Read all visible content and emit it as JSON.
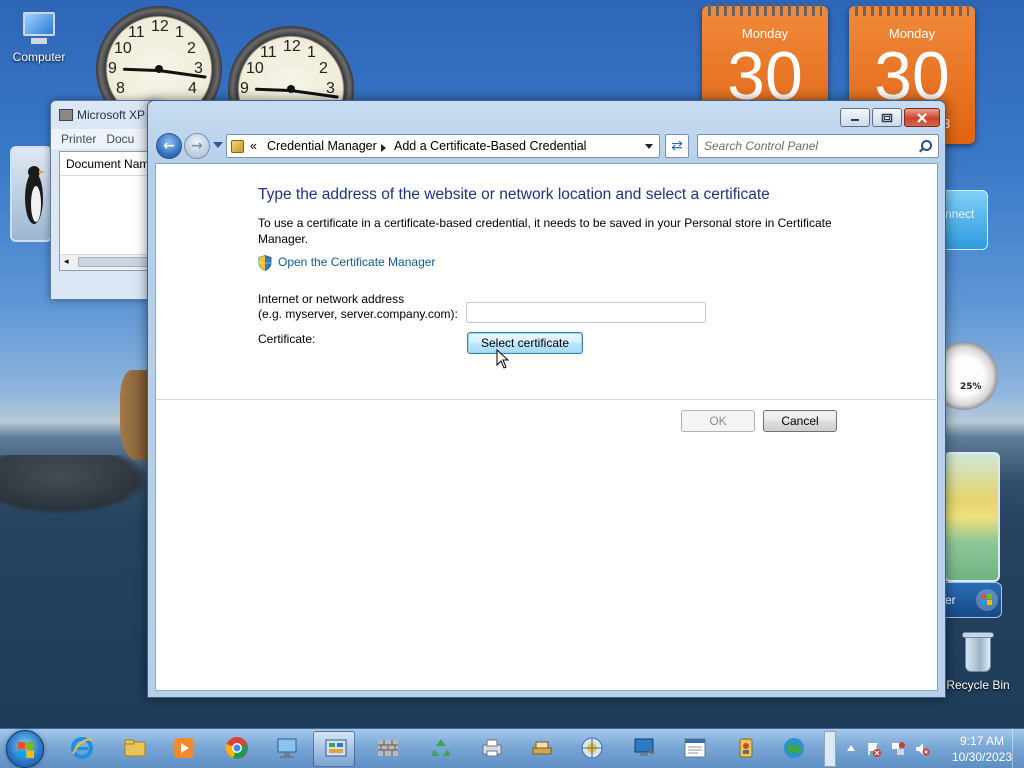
{
  "desktop": {
    "icons": {
      "computer": "Computer",
      "recycle_bin": "Recycle Bin"
    },
    "calendars": [
      {
        "day": "Monday",
        "date": "30"
      },
      {
        "day": "Monday",
        "date": "30"
      }
    ],
    "clocks": [
      {
        "numbers": [
          "12",
          "1",
          "2",
          "3",
          "4",
          "8",
          "9",
          "10",
          "11"
        ]
      },
      {
        "numbers": [
          "12",
          "1",
          "2",
          "3",
          "9",
          "10",
          "11"
        ]
      }
    ],
    "gadget_fragments": {
      "connect": "nnect",
      "meter": "25%",
      "calendar_tail": "3",
      "media_center": "er"
    }
  },
  "background_window": {
    "title": "Microsoft XP",
    "menu": [
      "Printer",
      "Docu"
    ],
    "column_header": "Document Nam"
  },
  "window": {
    "controls": [
      "minimize",
      "maximize",
      "close"
    ],
    "breadcrumb": {
      "overflow": "«",
      "items": [
        "Credential Manager",
        "Add a Certificate-Based Credential"
      ]
    },
    "search": {
      "placeholder": "Search Control Panel",
      "icon": "search-icon"
    },
    "heading": "Type the address of the website or network location and select a certificate",
    "description": "To use a certificate in a certificate-based credential, it needs to be saved in your Personal store in Certificate Manager.",
    "certificate_manager_link": "Open the Certificate Manager",
    "address_label_line1": "Internet or network address",
    "address_label_line2": "(e.g. myserver, server.company.com):",
    "address_value": "",
    "certificate_label": "Certificate:",
    "select_certificate_button": "Select certificate",
    "ok_button": "OK",
    "cancel_button": "Cancel"
  },
  "taskbar": {
    "pinned": [
      "internet-explorer-icon",
      "windows-explorer-icon",
      "media-player-icon",
      "chrome-icon",
      "network-icon",
      "control-panel-icon",
      "firewall-icon",
      "recycle-icon",
      "printer-icon",
      "tools-icon",
      "accessibility-icon",
      "computer-management-icon",
      "event-viewer-icon",
      "credential-icon",
      "globe-icon"
    ],
    "clock": {
      "time": "9:17 AM",
      "date": "10/30/2023"
    }
  },
  "colors": {
    "heading": "#1e3287",
    "link": "#0b5c96",
    "calendar": "#e06414"
  }
}
